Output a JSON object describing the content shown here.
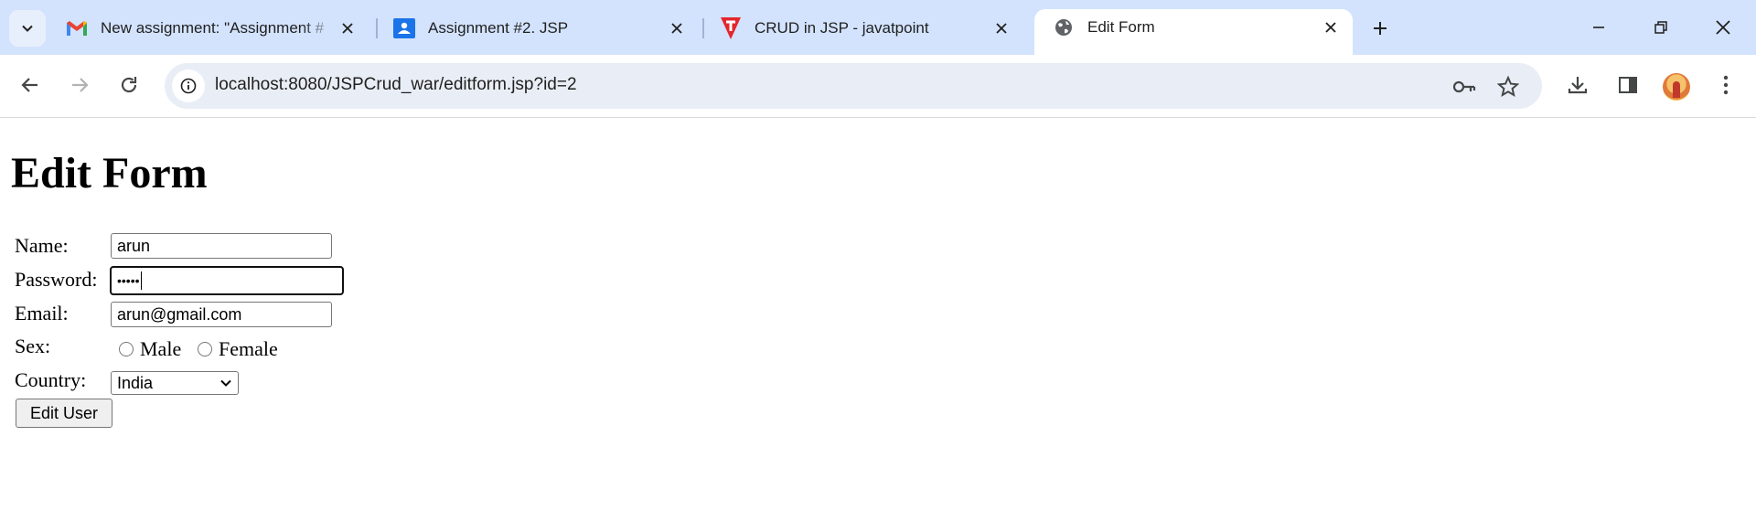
{
  "browser": {
    "tabs": [
      {
        "title": "New assignment: \"Assignment #",
        "icon": "gmail-icon"
      },
      {
        "title": "Assignment #2. JSP",
        "icon": "classroom-icon"
      },
      {
        "title": "CRUD in JSP - javatpoint",
        "icon": "javatpoint-icon"
      },
      {
        "title": "Edit Form",
        "icon": "globe-icon",
        "active": true
      }
    ],
    "url": "localhost:8080/JSPCrud_war/editform.jsp?id=2"
  },
  "page": {
    "title": "Edit Form",
    "form": {
      "name_label": "Name:",
      "name_value": "arun",
      "password_label": "Password:",
      "password_value": "•••••",
      "email_label": "Email:",
      "email_value": "arun@gmail.com",
      "sex_label": "Sex:",
      "sex_options": [
        "Male",
        "Female"
      ],
      "country_label": "Country:",
      "country_value": "India",
      "submit_label": "Edit User"
    }
  },
  "colors": {
    "tabstrip": "#d3e3fd",
    "omnibox": "#e9eef6",
    "gmail_red": "#ea4335",
    "classroom_blue": "#1a73e8",
    "javatpoint_red": "#e4262c"
  }
}
